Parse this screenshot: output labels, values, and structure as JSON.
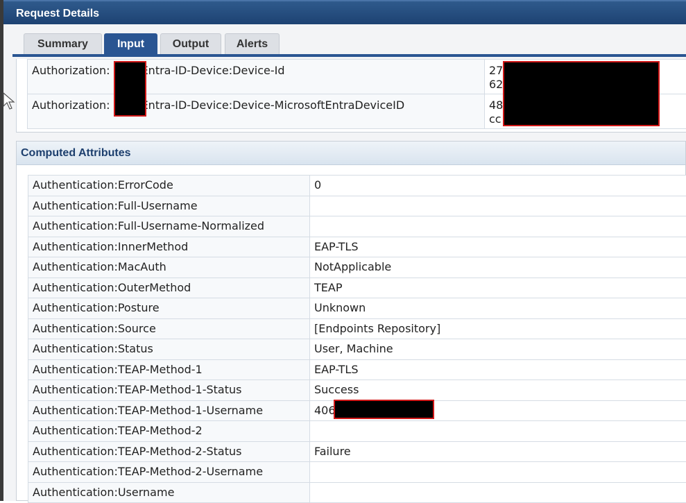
{
  "window": {
    "title": "Request Details"
  },
  "tabs": [
    {
      "label": "Summary",
      "active": false
    },
    {
      "label": "Input",
      "active": true
    },
    {
      "label": "Output",
      "active": false
    },
    {
      "label": "Alerts",
      "active": false
    }
  ],
  "input_attributes": [
    {
      "key_prefix": "Authorization:",
      "key_suffix": "Entra-ID-Device:Device-Id",
      "value_lines": [
        "27",
        "62"
      ]
    },
    {
      "key_prefix": "Authorization:",
      "key_suffix": "Entra-ID-Device:Device-MicrosoftEntraDeviceID",
      "value_lines": [
        "48",
        "cc"
      ]
    }
  ],
  "computed_attributes": {
    "title": "Computed Attributes",
    "rows": [
      {
        "key": "Authentication:ErrorCode",
        "value": "0"
      },
      {
        "key": "Authentication:Full-Username",
        "value": ""
      },
      {
        "key": "Authentication:Full-Username-Normalized",
        "value": ""
      },
      {
        "key": "Authentication:InnerMethod",
        "value": "EAP-TLS"
      },
      {
        "key": "Authentication:MacAuth",
        "value": "NotApplicable"
      },
      {
        "key": "Authentication:OuterMethod",
        "value": "TEAP"
      },
      {
        "key": "Authentication:Posture",
        "value": "Unknown"
      },
      {
        "key": "Authentication:Source",
        "value": "[Endpoints Repository]"
      },
      {
        "key": "Authentication:Status",
        "value": "User, Machine"
      },
      {
        "key": "Authentication:TEAP-Method-1",
        "value": "EAP-TLS"
      },
      {
        "key": "Authentication:TEAP-Method-1-Status",
        "value": "Success"
      },
      {
        "key": "Authentication:TEAP-Method-1-Username",
        "value": "406"
      },
      {
        "key": "Authentication:TEAP-Method-2",
        "value": ""
      },
      {
        "key": "Authentication:TEAP-Method-2-Status",
        "value": "Failure"
      },
      {
        "key": "Authentication:TEAP-Method-2-Username",
        "value": ""
      },
      {
        "key": "Authentication:Username",
        "value": ""
      }
    ]
  },
  "colors": {
    "titlebar": "#1d4272",
    "tab_active": "#2a5592",
    "redaction_border": "#d01818"
  }
}
